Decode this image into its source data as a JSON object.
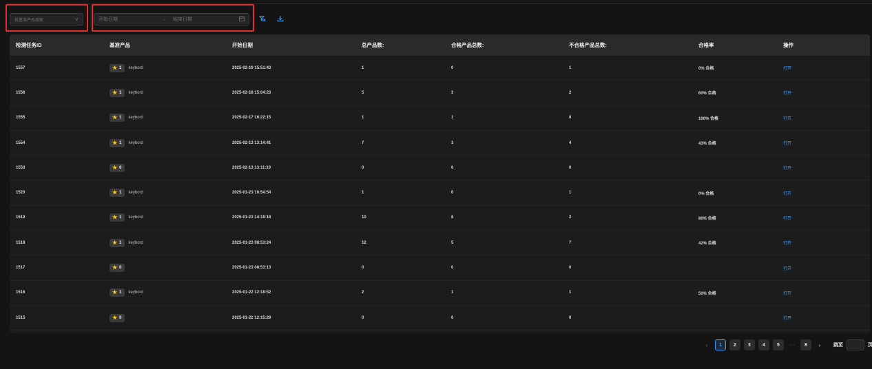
{
  "filters": {
    "product_placeholder": "按基准产品搜索",
    "start_date_placeholder": "开始日期",
    "range_arrow": "→",
    "end_date_placeholder": "结束日期"
  },
  "table": {
    "columns": [
      "检测任务ID",
      "基准产品",
      "开始日期",
      "总产品数:",
      "合格产品总数:",
      "不合格产品总数:",
      "合格率",
      "操作"
    ],
    "rows": [
      {
        "id": "1557",
        "stars": "1",
        "product": "keybord",
        "date": "2025-02-19 15:51:43",
        "total": "1",
        "pass": "0",
        "fail": "1",
        "rate": "0% 合格",
        "action": "打开"
      },
      {
        "id": "1556",
        "stars": "1",
        "product": "keybord",
        "date": "2025-02-18 15:04:23",
        "total": "5",
        "pass": "3",
        "fail": "2",
        "rate": "60% 合格",
        "action": "打开"
      },
      {
        "id": "1555",
        "stars": "1",
        "product": "keybord",
        "date": "2025-02-17 16:22:15",
        "total": "1",
        "pass": "1",
        "fail": "0",
        "rate": "100% 合格",
        "action": "打开"
      },
      {
        "id": "1554",
        "stars": "1",
        "product": "keybord",
        "date": "2025-02-13 13:14:41",
        "total": "7",
        "pass": "3",
        "fail": "4",
        "rate": "43% 合格",
        "action": "打开"
      },
      {
        "id": "1553",
        "stars": "0",
        "product": "",
        "date": "2025-02-13 13:11:19",
        "total": "0",
        "pass": "0",
        "fail": "0",
        "rate": "",
        "action": "打开"
      },
      {
        "id": "1520",
        "stars": "1",
        "product": "keybord",
        "date": "2025-01-23 16:54:54",
        "total": "1",
        "pass": "0",
        "fail": "1",
        "rate": "0% 合格",
        "action": "打开"
      },
      {
        "id": "1519",
        "stars": "1",
        "product": "keybord",
        "date": "2025-01-23 14:18:18",
        "total": "10",
        "pass": "8",
        "fail": "2",
        "rate": "80% 合格",
        "action": "打开"
      },
      {
        "id": "1518",
        "stars": "1",
        "product": "keybord",
        "date": "2025-01-23 08:53:24",
        "total": "12",
        "pass": "5",
        "fail": "7",
        "rate": "42% 合格",
        "action": "打开"
      },
      {
        "id": "1517",
        "stars": "0",
        "product": "",
        "date": "2025-01-23 08:53:13",
        "total": "0",
        "pass": "0",
        "fail": "0",
        "rate": "",
        "action": "打开"
      },
      {
        "id": "1516",
        "stars": "1",
        "product": "keybord",
        "date": "2025-01-22 12:18:52",
        "total": "2",
        "pass": "1",
        "fail": "1",
        "rate": "50% 合格",
        "action": "打开"
      },
      {
        "id": "1515",
        "stars": "0",
        "product": "",
        "date": "2025-01-22 12:15:29",
        "total": "0",
        "pass": "0",
        "fail": "0",
        "rate": "",
        "action": "打开"
      }
    ]
  },
  "pagination": {
    "prev": "‹",
    "pages": [
      "1",
      "2",
      "3",
      "4",
      "5"
    ],
    "active_page": "1",
    "ellipsis": "···",
    "last_page": "8",
    "next": "›",
    "jump_label": "跳至",
    "page_suffix": "页"
  },
  "colors": {
    "accent": "#3aa0ff",
    "star": "#f5c518",
    "highlight": "#e03030"
  }
}
